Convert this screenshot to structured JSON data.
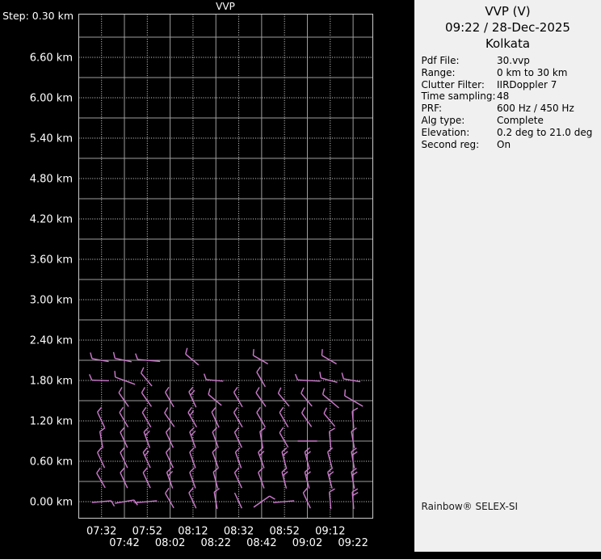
{
  "window": {
    "background": "#000000",
    "panel_background": "#f0f0f0"
  },
  "chart_data": {
    "type": "wind-barb-time-height-profile",
    "title": "VVP",
    "step_label": "Step: 0.30 km",
    "x_ticks": [
      "07:32",
      "07:42",
      "07:52",
      "08:02",
      "08:12",
      "08:22",
      "08:32",
      "08:42",
      "08:52",
      "09:02",
      "09:12",
      "09:22"
    ],
    "y_tick_labels": [
      "0.00 km",
      "0.60 km",
      "1.20 km",
      "1.80 km",
      "2.40 km",
      "3.00 km",
      "3.60 km",
      "4.20 km",
      "4.80 km",
      "5.40 km",
      "6.00 km",
      "6.60 km"
    ],
    "y_ticks_km": [
      0.0,
      0.6,
      1.2,
      1.8,
      2.4,
      3.0,
      3.6,
      4.2,
      4.8,
      5.4,
      6.0,
      6.6
    ],
    "height_step_km": 0.3,
    "ylim_km": [
      -0.25,
      7.2
    ],
    "grid": "dotted lines at labeled ticks, solid lines at intermediate ticks",
    "barb_format": "[time_index, height_km, staff_angle_deg, tick_count, length_px(optional)]",
    "barbs": [
      [
        0,
        2.1,
        170,
        1
      ],
      [
        1,
        2.1,
        168,
        1
      ],
      [
        2,
        2.1,
        175,
        1,
        28
      ],
      [
        4,
        2.1,
        140,
        1
      ],
      [
        7,
        2.1,
        150,
        1
      ],
      [
        10,
        2.1,
        150,
        1
      ],
      [
        0,
        1.8,
        178,
        1
      ],
      [
        1,
        1.8,
        160,
        1,
        26
      ],
      [
        2,
        1.8,
        130,
        1
      ],
      [
        5,
        1.8,
        175,
        1
      ],
      [
        7,
        1.8,
        120,
        1
      ],
      [
        9,
        1.8,
        177,
        1,
        28
      ],
      [
        10,
        1.8,
        165,
        1
      ],
      [
        11,
        1.8,
        170,
        1
      ],
      [
        1,
        1.5,
        125,
        1
      ],
      [
        2,
        1.5,
        125,
        1
      ],
      [
        3,
        1.5,
        120,
        1
      ],
      [
        4,
        1.5,
        115,
        2
      ],
      [
        5,
        1.5,
        140,
        1
      ],
      [
        6,
        1.5,
        120,
        1
      ],
      [
        7,
        1.5,
        125,
        1
      ],
      [
        8,
        1.5,
        130,
        1
      ],
      [
        9,
        1.5,
        130,
        1
      ],
      [
        10,
        1.5,
        140,
        1,
        26
      ],
      [
        11,
        1.5,
        150,
        1,
        26
      ],
      [
        0,
        1.2,
        115,
        1
      ],
      [
        1,
        1.2,
        120,
        1
      ],
      [
        2,
        1.2,
        120,
        1
      ],
      [
        3,
        1.2,
        125,
        1
      ],
      [
        4,
        1.2,
        120,
        2
      ],
      [
        5,
        1.2,
        115,
        1
      ],
      [
        6,
        1.2,
        120,
        1
      ],
      [
        7,
        1.2,
        120,
        1
      ],
      [
        8,
        1.2,
        120,
        1
      ],
      [
        9,
        1.2,
        125,
        1
      ],
      [
        10,
        1.2,
        130,
        1
      ],
      [
        11,
        1.2,
        95,
        1
      ],
      [
        0,
        0.9,
        100,
        1
      ],
      [
        1,
        0.9,
        115,
        1
      ],
      [
        2,
        0.9,
        110,
        2
      ],
      [
        3,
        0.9,
        115,
        1
      ],
      [
        4,
        0.9,
        110,
        2
      ],
      [
        5,
        0.9,
        110,
        1
      ],
      [
        6,
        0.9,
        115,
        1
      ],
      [
        7,
        0.9,
        100,
        1
      ],
      [
        8,
        0.9,
        120,
        1
      ],
      [
        9,
        0.9,
        0,
        0,
        24
      ],
      [
        10,
        0.9,
        95,
        1
      ],
      [
        11,
        0.9,
        100,
        1
      ],
      [
        0,
        0.6,
        115,
        1
      ],
      [
        1,
        0.6,
        115,
        1
      ],
      [
        2,
        0.6,
        115,
        2
      ],
      [
        3,
        0.6,
        115,
        1
      ],
      [
        4,
        0.6,
        110,
        1
      ],
      [
        5,
        0.6,
        110,
        1
      ],
      [
        6,
        0.6,
        110,
        1
      ],
      [
        7,
        0.6,
        110,
        2
      ],
      [
        8,
        0.6,
        105,
        2
      ],
      [
        9,
        0.6,
        105,
        2
      ],
      [
        10,
        0.6,
        105,
        1
      ],
      [
        11,
        0.6,
        100,
        2
      ],
      [
        0,
        0.3,
        120,
        1
      ],
      [
        1,
        0.3,
        115,
        1
      ],
      [
        2,
        0.3,
        115,
        1
      ],
      [
        3,
        0.3,
        110,
        2
      ],
      [
        4,
        0.3,
        110,
        1
      ],
      [
        5,
        0.3,
        105,
        1
      ],
      [
        6,
        0.3,
        115,
        1
      ],
      [
        7,
        0.3,
        110,
        1
      ],
      [
        8,
        0.3,
        105,
        2
      ],
      [
        9,
        0.3,
        105,
        2
      ],
      [
        10,
        0.3,
        105,
        2
      ],
      [
        11,
        0.3,
        100,
        2
      ],
      [
        0,
        0.0,
        5,
        1,
        24
      ],
      [
        1,
        0.0,
        10,
        1,
        24
      ],
      [
        2,
        0.0,
        5,
        0,
        28
      ],
      [
        3,
        0.0,
        120,
        1
      ],
      [
        4,
        0.0,
        115,
        1
      ],
      [
        5,
        0.0,
        100,
        1
      ],
      [
        6,
        0.0,
        115,
        0
      ],
      [
        7,
        0.0,
        35,
        1,
        24
      ],
      [
        8,
        0.0,
        5,
        0,
        26
      ],
      [
        9,
        0.0,
        115,
        1
      ],
      [
        10,
        0.0,
        95,
        1
      ],
      [
        11,
        0.0,
        95,
        2
      ]
    ],
    "colors": {
      "barb": "#cd7bce",
      "grid_solid": "#9e9e9e",
      "grid_dot": "#dedede",
      "border": "#cccccc",
      "axis_text": "#ffffff"
    }
  },
  "panel": {
    "title": "VVP (V)",
    "datetime": "09:22 / 28-Dec-2025",
    "station": "Kolkata",
    "params": [
      {
        "label": "Pdf File:",
        "value": "30.vvp"
      },
      {
        "label": "Range:",
        "value": "0 km to 30 km"
      },
      {
        "label": "Clutter Filter:",
        "value": "IIRDoppler 7"
      },
      {
        "label": "Time sampling:",
        "value": "48"
      },
      {
        "label": "PRF:",
        "value": "600 Hz / 450 Hz"
      },
      {
        "label": "Alg type:",
        "value": "Complete"
      },
      {
        "label": "Elevation:",
        "value": "0.2 deg to 21.0 deg"
      },
      {
        "label": "Second reg:",
        "value": "On"
      }
    ],
    "footer": "Rainbow® SELEX-SI"
  }
}
